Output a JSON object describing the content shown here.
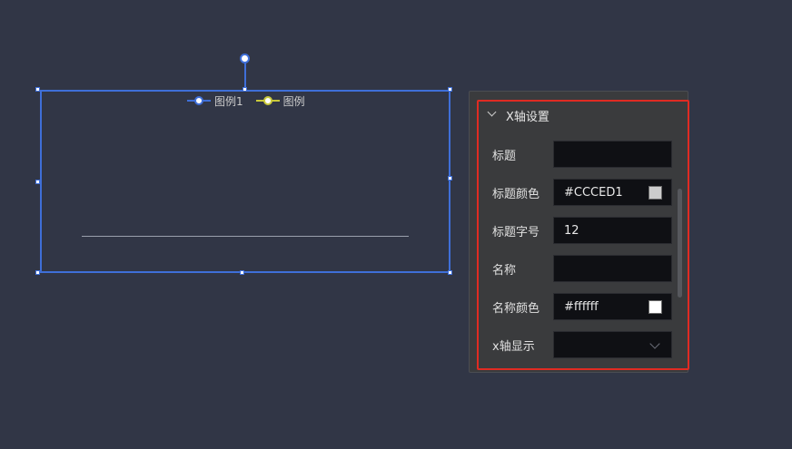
{
  "chart_widget": {
    "legend": [
      {
        "label": "图例1",
        "color": "#3f6fd8"
      },
      {
        "label": "图例",
        "color": "#c9c93a"
      }
    ]
  },
  "panel": {
    "section_title": "X轴设置",
    "fields": {
      "title": {
        "label": "标题",
        "value": ""
      },
      "title_color": {
        "label": "标题颜色",
        "value": "#CCCED1",
        "swatch": "#cccccc"
      },
      "title_font_size": {
        "label": "标题字号",
        "value": "12"
      },
      "name": {
        "label": "名称",
        "value": ""
      },
      "name_color": {
        "label": "名称颜色",
        "value": "#ffffff",
        "swatch": "#ffffff"
      },
      "x_axis_display": {
        "label": "x轴显示",
        "value": ""
      }
    }
  },
  "colors": {
    "background": "#313646",
    "selection": "#3f6fd8",
    "highlight": "#e02b22",
    "panel": "#3a3b3d",
    "field": "#0f1014"
  }
}
